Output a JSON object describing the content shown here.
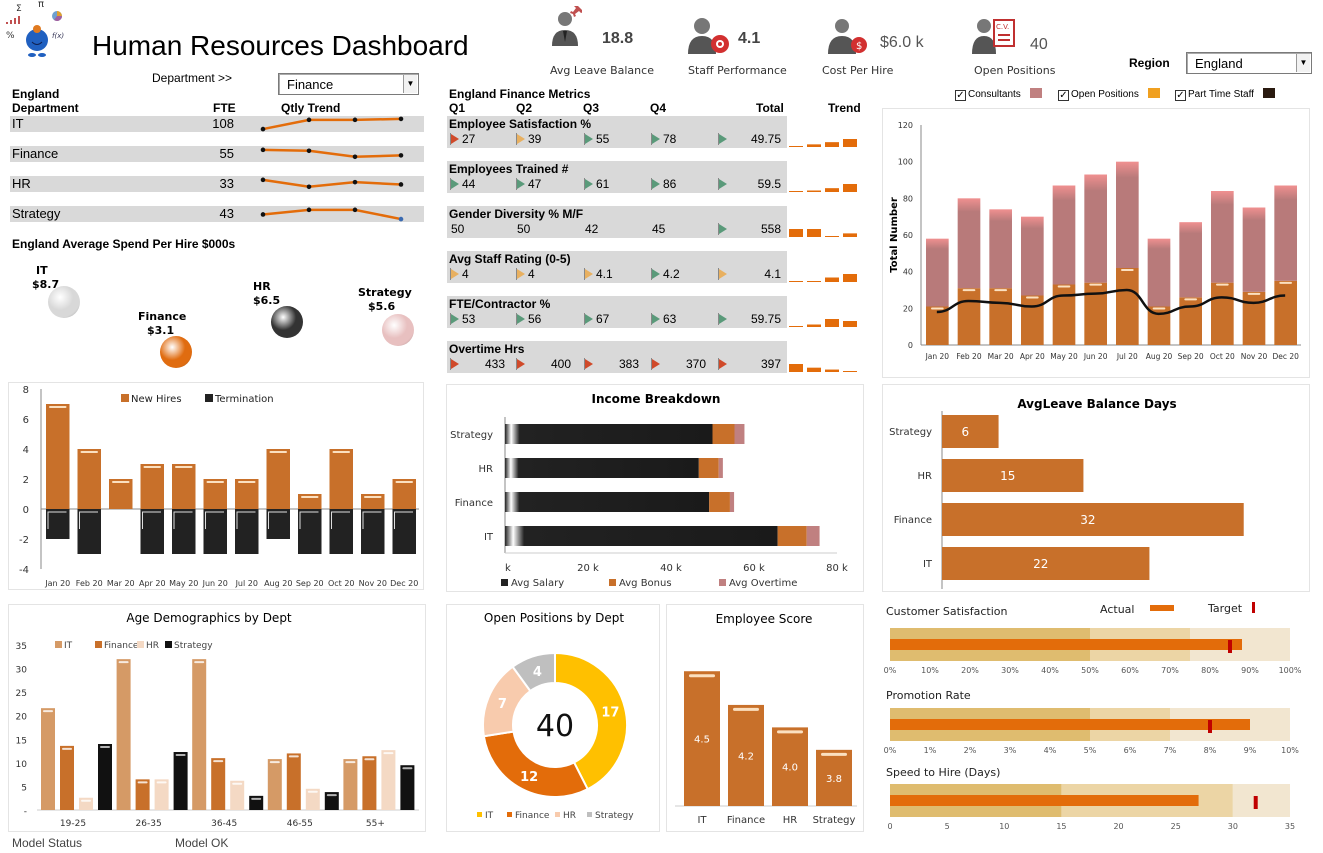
{
  "header": {
    "title": "Human Resources Dashboard",
    "department_label": "Department >>",
    "department_value": "Finance",
    "region_label": "Region",
    "region_value": "England"
  },
  "kpis": [
    {
      "icon": "leave-icon",
      "value": "18.8",
      "label": "Avg Leave Balance"
    },
    {
      "icon": "performance-icon",
      "value": "4.1",
      "label": "Staff Performance"
    },
    {
      "icon": "cost-icon",
      "value": "$6.0 k",
      "label": "Cost Per Hire"
    },
    {
      "icon": "cv-icon",
      "value": "40",
      "label": "Open Positions"
    }
  ],
  "fte_table": {
    "region": "England",
    "col_dept": "Department",
    "col_fte": "FTE",
    "col_trend": "Qtly Trend",
    "rows": [
      {
        "dept": "IT",
        "fte": "108",
        "trend": [
          1,
          3,
          3,
          3.2
        ]
      },
      {
        "dept": "Finance",
        "fte": "55",
        "trend": [
          3,
          2.8,
          1.5,
          1.8
        ]
      },
      {
        "dept": "HR",
        "fte": "33",
        "trend": [
          3,
          1.5,
          2.5,
          2
        ]
      },
      {
        "dept": "Strategy",
        "fte": "43",
        "trend": [
          2,
          3,
          3,
          1
        ]
      }
    ]
  },
  "spend_per_hire": {
    "title": "England Average Spend Per Hire $000s",
    "items": [
      {
        "dept": "IT",
        "value": "$8.7",
        "color": "#d8d8d8"
      },
      {
        "dept": "Finance",
        "value": "$3.1",
        "color": "#e06c10"
      },
      {
        "dept": "HR",
        "value": "$6.5",
        "color": "#333333"
      },
      {
        "dept": "Strategy",
        "value": "$5.6",
        "color": "#e8c0c0"
      }
    ]
  },
  "metrics": {
    "title": "England Finance Metrics",
    "headers": [
      "Q1",
      "Q2",
      "Q3",
      "Q4",
      "Total",
      "Trend"
    ],
    "rows": [
      {
        "label": "Employee Satisfaction %",
        "vals": [
          "27",
          "39",
          "55",
          "78"
        ],
        "flags": [
          "red",
          "amb",
          "grn",
          "grn",
          "grn"
        ],
        "total": "49.75",
        "trend": [
          27,
          39,
          55,
          78
        ]
      },
      {
        "label": "Employees Trained #",
        "vals": [
          "44",
          "47",
          "61",
          "86"
        ],
        "flags": [
          "grn",
          "grn",
          "grn",
          "grn",
          "grn"
        ],
        "total": "59.5",
        "trend": [
          44,
          47,
          61,
          86
        ]
      },
      {
        "label": "Gender Diversity % M/F",
        "vals": [
          "50",
          "50",
          "42",
          "45"
        ],
        "flags": [
          "",
          "",
          "",
          "",
          "grn"
        ],
        "total": "558",
        "trend": [
          50,
          50,
          42,
          45
        ]
      },
      {
        "label": "Avg Staff Rating (0-5)",
        "vals": [
          "4",
          "4",
          "4.1",
          "4.2"
        ],
        "flags": [
          "amb",
          "amb",
          "amb",
          "grn",
          "amb"
        ],
        "total": "4.1",
        "trend": [
          4,
          4,
          4.1,
          4.2
        ]
      },
      {
        "label": "FTE/Contractor %",
        "vals": [
          "53",
          "56",
          "67",
          "63"
        ],
        "flags": [
          "grn",
          "grn",
          "grn",
          "grn",
          "grn"
        ],
        "total": "59.75",
        "trend": [
          53,
          56,
          67,
          63
        ]
      },
      {
        "label": "Overtime Hrs",
        "vals": [
          "433",
          "400",
          "383",
          "370"
        ],
        "flags": [
          "red",
          "red",
          "red",
          "red",
          "red"
        ],
        "total": "397",
        "trend": [
          433,
          400,
          383,
          370
        ]
      }
    ]
  },
  "legend_checks": [
    {
      "label": "Consultants",
      "color": "#c08080",
      "checked": true
    },
    {
      "label": "Open Positions",
      "color": "#f0a020",
      "checked": true
    },
    {
      "label": "Part Time Staff",
      "color": "#2a1a10",
      "checked": true
    }
  ],
  "chart_data": [
    {
      "id": "staffing",
      "type": "bar",
      "title": "",
      "ylabel": "Total Number",
      "ylim": [
        0,
        120
      ],
      "yticks": [
        0,
        20,
        40,
        60,
        80,
        100,
        120
      ],
      "categories": [
        "Jan 20",
        "Feb 20",
        "Mar 20",
        "Apr 20",
        "May 20",
        "Jun 20",
        "Jul 20",
        "Aug 20",
        "Sep 20",
        "Oct 20",
        "Nov 20",
        "Dec 20"
      ],
      "series": [
        {
          "name": "Open Positions",
          "kind": "stacked-bar",
          "values": [
            21,
            31,
            31,
            27,
            33,
            34,
            42,
            21,
            26,
            34,
            29,
            35
          ]
        },
        {
          "name": "Consultants",
          "kind": "stacked-bar",
          "values": [
            37,
            49,
            43,
            43,
            54,
            59,
            58,
            37,
            41,
            50,
            46,
            52
          ]
        },
        {
          "name": "Part Time Staff",
          "kind": "line",
          "values": [
            18,
            24,
            23,
            21,
            27,
            28,
            30,
            17,
            21,
            26,
            23,
            27
          ]
        }
      ]
    },
    {
      "id": "hires",
      "type": "bar",
      "title": "",
      "ylim": [
        -4,
        8
      ],
      "yticks": [
        -4,
        -2,
        0,
        2,
        4,
        6,
        8
      ],
      "legend": "top",
      "categories": [
        "Jan 20",
        "Feb 20",
        "Mar 20",
        "Apr 20",
        "May 20",
        "Jun 20",
        "Jul 20",
        "Aug 20",
        "Sep 20",
        "Oct 20",
        "Nov 20",
        "Dec 20"
      ],
      "series": [
        {
          "name": "New Hires",
          "values": [
            7,
            4,
            2,
            3,
            3,
            2,
            2,
            4,
            1,
            4,
            1,
            2
          ]
        },
        {
          "name": "Termination",
          "values": [
            -2,
            -3,
            0,
            -3,
            -3,
            -3,
            -3,
            -2,
            -3,
            -3,
            -3,
            -3
          ]
        }
      ]
    },
    {
      "id": "income",
      "type": "bar",
      "orientation": "horizontal-stacked",
      "title": "Income Breakdown",
      "xlim": [
        0,
        80000
      ],
      "xticks": [
        "k",
        "20 k",
        "40 k",
        "60 k",
        "80 k"
      ],
      "legend": "bottom",
      "categories": [
        "Strategy",
        "HR",
        "Finance",
        "IT"
      ],
      "series": [
        {
          "name": "Avg Salary",
          "values": [
            50000,
            46700,
            49200,
            65700
          ]
        },
        {
          "name": "Avg Bonus",
          "values": [
            5300,
            4800,
            5000,
            7000
          ]
        },
        {
          "name": "Avg Overtime",
          "values": [
            2400,
            1000,
            1000,
            3100
          ]
        }
      ]
    },
    {
      "id": "leave",
      "type": "bar",
      "orientation": "horizontal",
      "title": "AvgLeave Balance Days",
      "xlim": [
        0,
        35
      ],
      "categories": [
        "Strategy",
        "HR",
        "Finance",
        "IT"
      ],
      "values": [
        6,
        15,
        32,
        22
      ]
    },
    {
      "id": "age",
      "type": "bar",
      "title": "Age Demographics by Dept",
      "ylim": [
        0,
        35
      ],
      "yticks": [
        "-",
        "5",
        "10",
        "15",
        "20",
        "25",
        "30",
        "35"
      ],
      "legend": "top-left",
      "categories": [
        "19-25",
        "26-35",
        "36-45",
        "46-55",
        "55+"
      ],
      "series": [
        {
          "name": "IT",
          "values": [
            21.6,
            32,
            32,
            10.8,
            10.8
          ]
        },
        {
          "name": "Finance",
          "values": [
            13.6,
            6.5,
            11,
            12,
            11.4
          ]
        },
        {
          "name": "HR",
          "values": [
            2.6,
            6.5,
            6.2,
            4.5,
            12.7
          ]
        },
        {
          "name": "Strategy",
          "values": [
            14,
            12.3,
            3,
            3.8,
            9.5
          ]
        }
      ]
    },
    {
      "id": "open_positions",
      "type": "pie",
      "title": "Open Positions by Dept",
      "center_label": "40",
      "legend": "bottom",
      "categories": [
        "IT",
        "Finance",
        "HR",
        "Strategy"
      ],
      "values": [
        17,
        12,
        7,
        4
      ]
    },
    {
      "id": "emp_score",
      "type": "bar",
      "title": "Employee Score",
      "ylim": [
        0,
        5
      ],
      "categories": [
        "IT",
        "Finance",
        "HR",
        "Strategy"
      ],
      "values": [
        4.5,
        4.2,
        4.0,
        3.8
      ],
      "labels": [
        "4.5",
        "4.2",
        "4.0",
        "3.8"
      ]
    },
    {
      "id": "bullets",
      "type": "bar",
      "orientation": "bullet",
      "legend": {
        "actual": "Actual",
        "target": "Target"
      },
      "items": [
        {
          "title": "Customer Satisfaction",
          "bands": [
            50,
            75,
            100
          ],
          "actual": 88,
          "target": 85,
          "max": 100,
          "ticks": [
            "0%",
            "10%",
            "20%",
            "30%",
            "40%",
            "50%",
            "60%",
            "70%",
            "80%",
            "90%",
            "100%"
          ]
        },
        {
          "title": "Promotion Rate",
          "bands": [
            5,
            7,
            10
          ],
          "actual": 9,
          "target": 8,
          "max": 10,
          "ticks": [
            "0%",
            "1%",
            "2%",
            "3%",
            "4%",
            "5%",
            "6%",
            "7%",
            "8%",
            "9%",
            "10%"
          ]
        },
        {
          "title": "Speed to Hire (Days)",
          "bands": [
            15,
            30,
            35
          ],
          "actual": 27,
          "target": 32,
          "max": 35,
          "ticks": [
            "0",
            "5",
            "10",
            "15",
            "20",
            "25",
            "30",
            "35"
          ]
        }
      ]
    }
  ],
  "footer": {
    "status_label": "Model Status",
    "status_value": "Model OK"
  },
  "colors": {
    "orange": "#c8702a",
    "bright_orange": "#e36c0a",
    "pink": "#b87a7a",
    "dark": "#222222",
    "yellow": "#ffc000",
    "target_red": "#c00000"
  }
}
